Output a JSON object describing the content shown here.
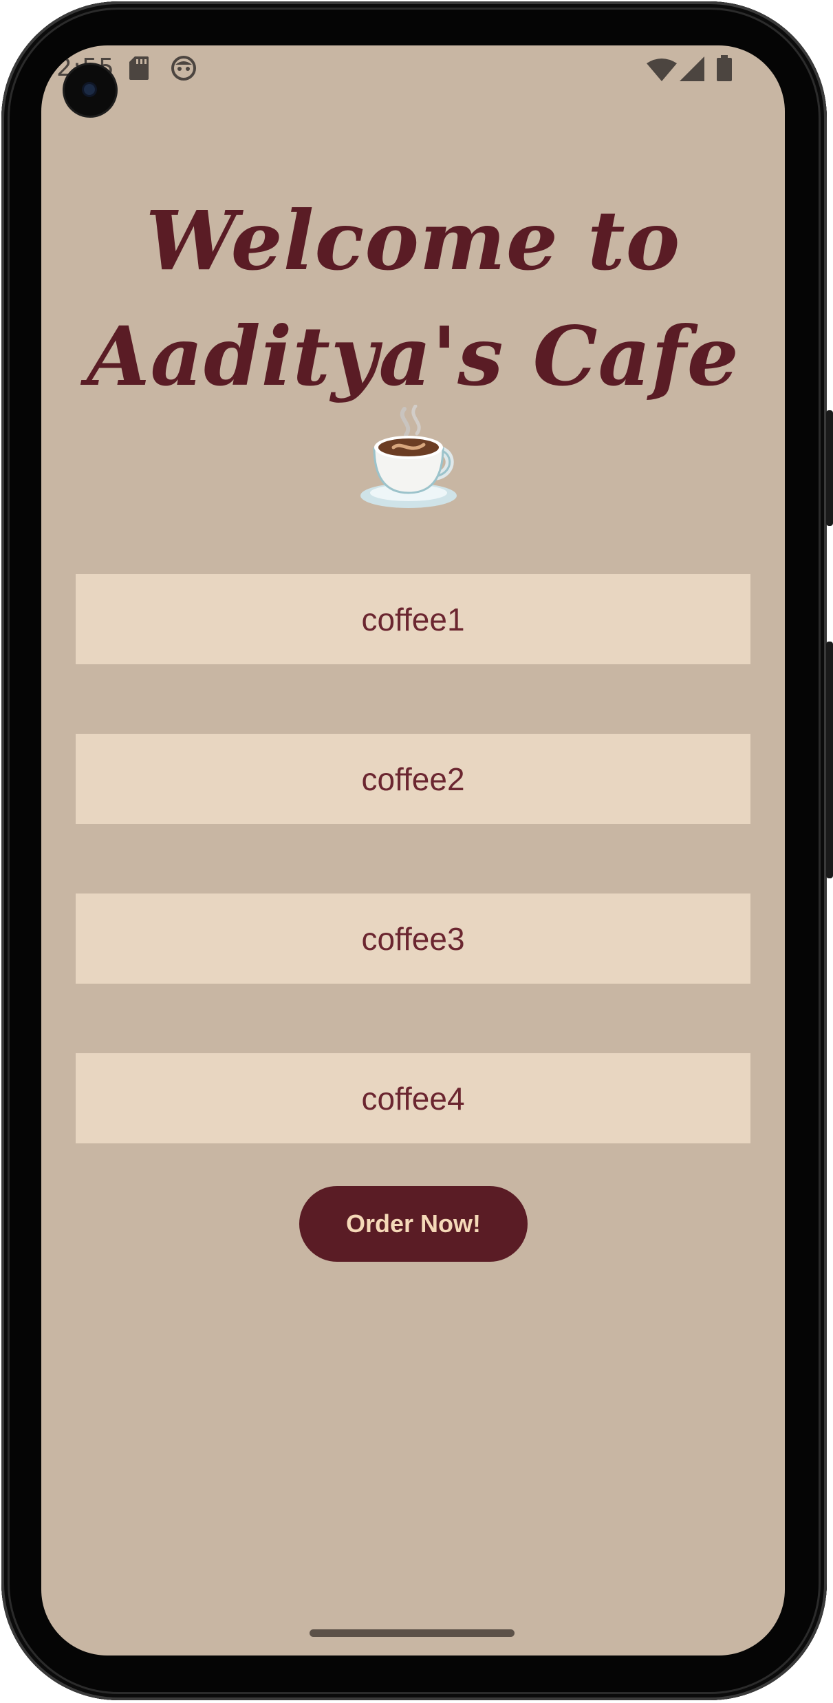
{
  "status_bar": {
    "time": "2:55",
    "left_icons": [
      "sd-card-icon",
      "face-icon"
    ],
    "right_icons": [
      "wifi-icon",
      "signal-icon",
      "battery-icon"
    ]
  },
  "header": {
    "title_line1": "Welcome to",
    "title_line2": "Aaditya's Cafe"
  },
  "menu": {
    "items": [
      {
        "label": "coffee1"
      },
      {
        "label": "coffee2"
      },
      {
        "label": "coffee3"
      },
      {
        "label": "coffee4"
      }
    ]
  },
  "actions": {
    "order_label": "Order Now!"
  },
  "colors": {
    "background": "#c8b6a3",
    "item_background": "#e8d6c1",
    "title_text": "#5a1c25",
    "item_text": "#6b2630",
    "button_background": "#5a1c25",
    "button_text": "#f5d9b8"
  }
}
